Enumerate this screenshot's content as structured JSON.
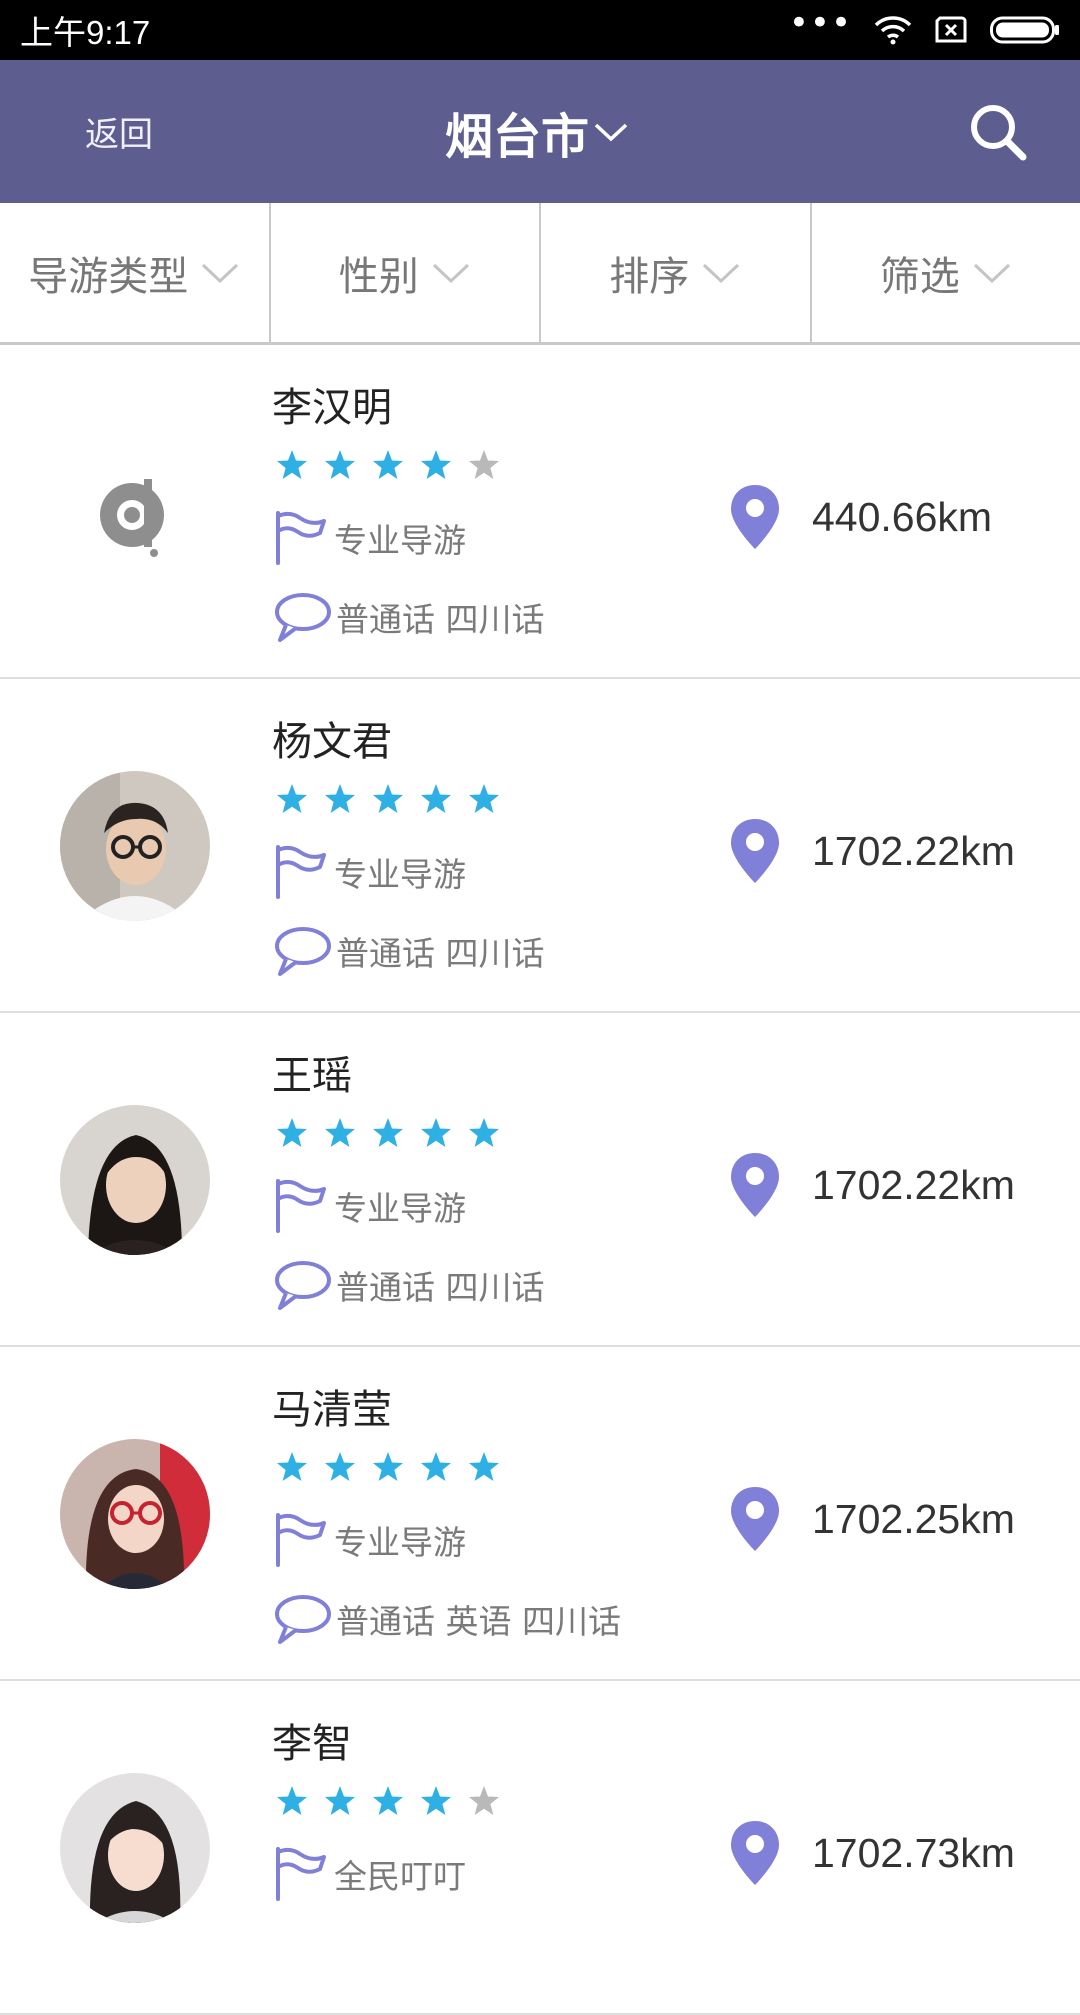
{
  "status_bar": {
    "time": "上午9:17",
    "icons": [
      "more-dots-icon",
      "wifi-icon",
      "sim-x-icon",
      "battery-icon"
    ]
  },
  "header": {
    "back_label": "返回",
    "city": "烟台市",
    "city_icon": "chevron-down-icon",
    "search_icon": "search-icon",
    "bg_color": "#5d5d8f"
  },
  "filters": [
    {
      "label": "导游类型"
    },
    {
      "label": "性别"
    },
    {
      "label": "排序"
    },
    {
      "label": "筛选"
    }
  ],
  "guides": [
    {
      "name": "李汉明",
      "rating": 4,
      "type": "专业导游",
      "languages": "普通话 四川话",
      "distance": "440.66km",
      "avatar": "default-logo"
    },
    {
      "name": "杨文君",
      "rating": 5,
      "type": "专业导游",
      "languages": "普通话 四川话",
      "distance": "1702.22km",
      "avatar": "photo-man-glasses"
    },
    {
      "name": "王瑶",
      "rating": 5,
      "type": "专业导游",
      "languages": "普通话 四川话",
      "distance": "1702.22km",
      "avatar": "photo-woman"
    },
    {
      "name": "马清莹",
      "rating": 5,
      "type": "专业导游",
      "languages": "普通话 英语 四川话",
      "distance": "1702.25km",
      "avatar": "photo-woman-glasses"
    },
    {
      "name": "李智",
      "rating": 4,
      "type": "全民叮叮",
      "languages": "",
      "distance": "1702.73km",
      "avatar": "photo-woman-2"
    }
  ],
  "colors": {
    "star_active": "#2eb0e4",
    "star_inactive": "#b9b9b9",
    "icon_purple": "#8080d8"
  }
}
